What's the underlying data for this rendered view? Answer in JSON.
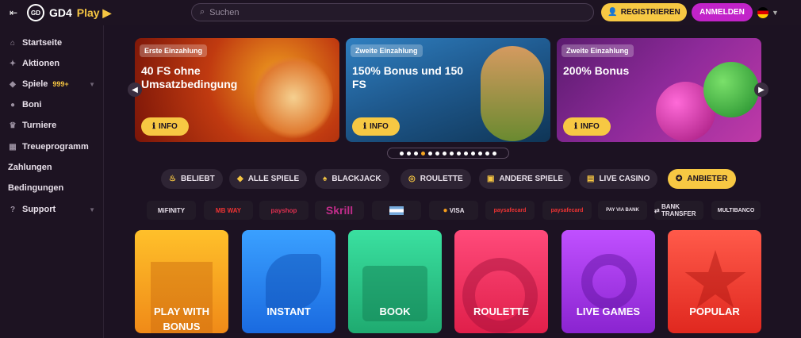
{
  "header": {
    "brand": "GD4",
    "brand_play": "Play",
    "search_placeholder": "Suchen",
    "register_label": "REGISTRIEREN",
    "login_label": "ANMELDEN"
  },
  "sidebar": {
    "items": [
      {
        "label": "Startseite",
        "icon": "home-icon"
      },
      {
        "label": "Aktionen",
        "icon": "megaphone-icon"
      },
      {
        "label": "Spiele",
        "badge": "999+",
        "icon": "gamepad-icon"
      },
      {
        "label": "Boni",
        "icon": "coin-icon"
      },
      {
        "label": "Turniere",
        "icon": "trophy-icon"
      },
      {
        "label": "Treueprogramm",
        "icon": "loyalty-icon"
      },
      {
        "label": "Zahlungen"
      },
      {
        "label": "Bedingungen"
      },
      {
        "label": "Support",
        "icon": "help-icon"
      }
    ]
  },
  "banners": [
    {
      "tag": "Erste Einzahlung",
      "title": "40 FS ohne Umsatzbedingung",
      "button": "INFO"
    },
    {
      "tag": "Zweite Einzahlung",
      "title": "150% Bonus und 150 FS",
      "button": "INFO"
    },
    {
      "tag": "Zweite Einzahlung",
      "title": "200% Bonus",
      "button": "INFO"
    }
  ],
  "carousel": {
    "dot_count": 14,
    "active_index": 3
  },
  "categories": [
    {
      "label": "BELIEBT",
      "icon": "flame-icon"
    },
    {
      "label": "ALLE SPIELE",
      "icon": "gamepad-icon"
    },
    {
      "label": "BLACKJACK",
      "icon": "spade-icon"
    },
    {
      "label": "ROULETTE",
      "icon": "roulette-icon"
    },
    {
      "label": "ANDERE SPIELE",
      "icon": "grid-icon"
    },
    {
      "label": "LIVE CASINO",
      "icon": "live-icon"
    },
    {
      "label": "ANBIETER",
      "icon": "compass-icon",
      "active": true
    }
  ],
  "payments": [
    "MiFINITY",
    "MB WAY",
    "payshop",
    "Skrill",
    "",
    "VISA",
    "paysafecard",
    "paysafecard",
    "PAY VIA BANK",
    "BANK TRANSFER",
    "MULTIBANCO"
  ],
  "tiles": [
    {
      "label": "PLAY WITH BONUS",
      "color": "#f5a020"
    },
    {
      "label": "INSTANT",
      "color": "#2a8cf5"
    },
    {
      "label": "BOOK",
      "color": "#2fc98a"
    },
    {
      "label": "ROULETTE",
      "color": "#f0305a"
    },
    {
      "label": "LIVE GAMES",
      "color": "#a23ad8"
    },
    {
      "label": "POPULAR",
      "color": "#f0403a"
    }
  ]
}
